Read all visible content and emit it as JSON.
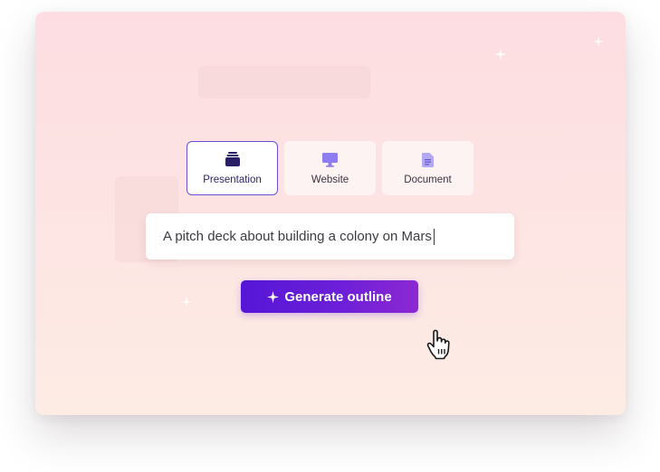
{
  "tabs": [
    {
      "label": "Presentation",
      "icon": "presentation-icon",
      "active": true
    },
    {
      "label": "Website",
      "icon": "monitor-icon",
      "active": false
    },
    {
      "label": "Document",
      "icon": "document-icon",
      "active": false
    }
  ],
  "prompt": {
    "value": "A pitch deck about building a colony on Mars"
  },
  "generate": {
    "icon": "sparkle-icon",
    "label": "Generate outline"
  },
  "colors": {
    "accent": "#6b4fd8",
    "button_start": "#5516d6",
    "button_end": "#8c28d3",
    "icon_presentation": "#2a1f66",
    "icon_inactive": "#8e7df0",
    "background_top": "#fddde2",
    "background_bottom": "#fdece4"
  }
}
